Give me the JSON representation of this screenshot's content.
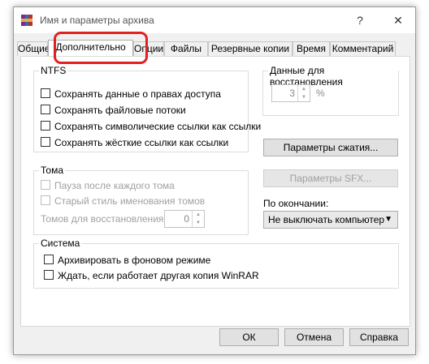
{
  "window": {
    "title": "Имя и параметры архива",
    "help": "?",
    "close": "✕"
  },
  "tabs": [
    {
      "label": "Общие"
    },
    {
      "label": "Дополнительно"
    },
    {
      "label": "Опции"
    },
    {
      "label": "Файлы"
    },
    {
      "label": "Резервные копии"
    },
    {
      "label": "Время"
    },
    {
      "label": "Комментарий"
    }
  ],
  "ntfs": {
    "title": "NTFS",
    "items": [
      {
        "label": "Сохранять данные о правах доступа",
        "checked": false
      },
      {
        "label": "Сохранять файловые потоки",
        "checked": false
      },
      {
        "label": "Сохранять символические ссылки как ссылки",
        "checked": false
      },
      {
        "label": "Сохранять жёсткие ссылки как ссылки",
        "checked": false
      }
    ]
  },
  "recovery": {
    "title": "Данные для восстановления",
    "value": "3",
    "unit": "%"
  },
  "compression_button": "Параметры сжатия...",
  "sfx_button": "Параметры SFX...",
  "volumes": {
    "title": "Тома",
    "pause_label": "Пауза после каждого тома",
    "old_style_label": "Старый стиль именования томов",
    "recovery_volumes_label": "Томов для восстановления:",
    "recovery_volumes_value": "0"
  },
  "on_completion": {
    "label": "По окончании:",
    "selected": "Не выключать компьютер"
  },
  "system": {
    "title": "Система",
    "background_label": "Архивировать в фоновом режиме",
    "wait_label": "Ждать, если работает другая копия WinRAR"
  },
  "buttons": {
    "ok": "ОК",
    "cancel": "Отмена",
    "help": "Справка"
  },
  "colors": {
    "highlight": "#e32020",
    "window_bg": "#f0f0f0"
  }
}
